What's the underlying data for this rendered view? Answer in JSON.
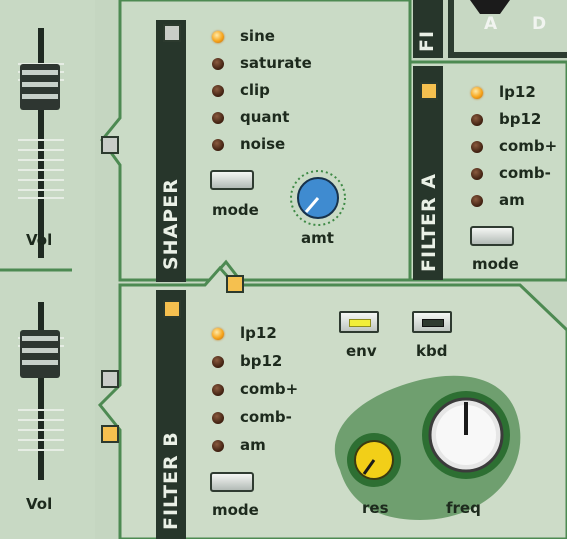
{
  "shaper": {
    "title": "SHAPER",
    "modes": [
      {
        "label": "sine",
        "active": true
      },
      {
        "label": "saturate",
        "active": false
      },
      {
        "label": "clip",
        "active": false
      },
      {
        "label": "quant",
        "active": false
      },
      {
        "label": "noise",
        "active": false
      }
    ],
    "mode_label": "mode",
    "amt_label": "amt"
  },
  "filter_a": {
    "title": "FILTER A",
    "types": [
      {
        "label": "lp12",
        "active": true
      },
      {
        "label": "bp12",
        "active": false
      },
      {
        "label": "comb+",
        "active": false
      },
      {
        "label": "comb-",
        "active": false
      },
      {
        "label": "am",
        "active": false
      }
    ],
    "mode_label": "mode"
  },
  "filter_b": {
    "title": "FILTER B",
    "types": [
      {
        "label": "lp12",
        "active": true
      },
      {
        "label": "bp12",
        "active": false
      },
      {
        "label": "comb+",
        "active": false
      },
      {
        "label": "comb-",
        "active": false
      },
      {
        "label": "am",
        "active": false
      }
    ],
    "mode_label": "mode",
    "env_label": "env",
    "kbd_label": "kbd",
    "res_label": "res",
    "freq_label": "freq",
    "env_on": true,
    "kbd_on": false
  },
  "top_partial": {
    "title": "FI",
    "letters": [
      "A",
      "D"
    ]
  },
  "vol_labels": [
    "Vol",
    "Vol"
  ],
  "colors": {
    "panel": "#c9dac5",
    "panel_light": "#d6e3d2",
    "border": "#4f8a54",
    "title_bar": "#2a3a2e",
    "led_on": "#f7a51c",
    "knob_blue": "#3f8bd0",
    "knob_yellow": "#f2cf18"
  }
}
